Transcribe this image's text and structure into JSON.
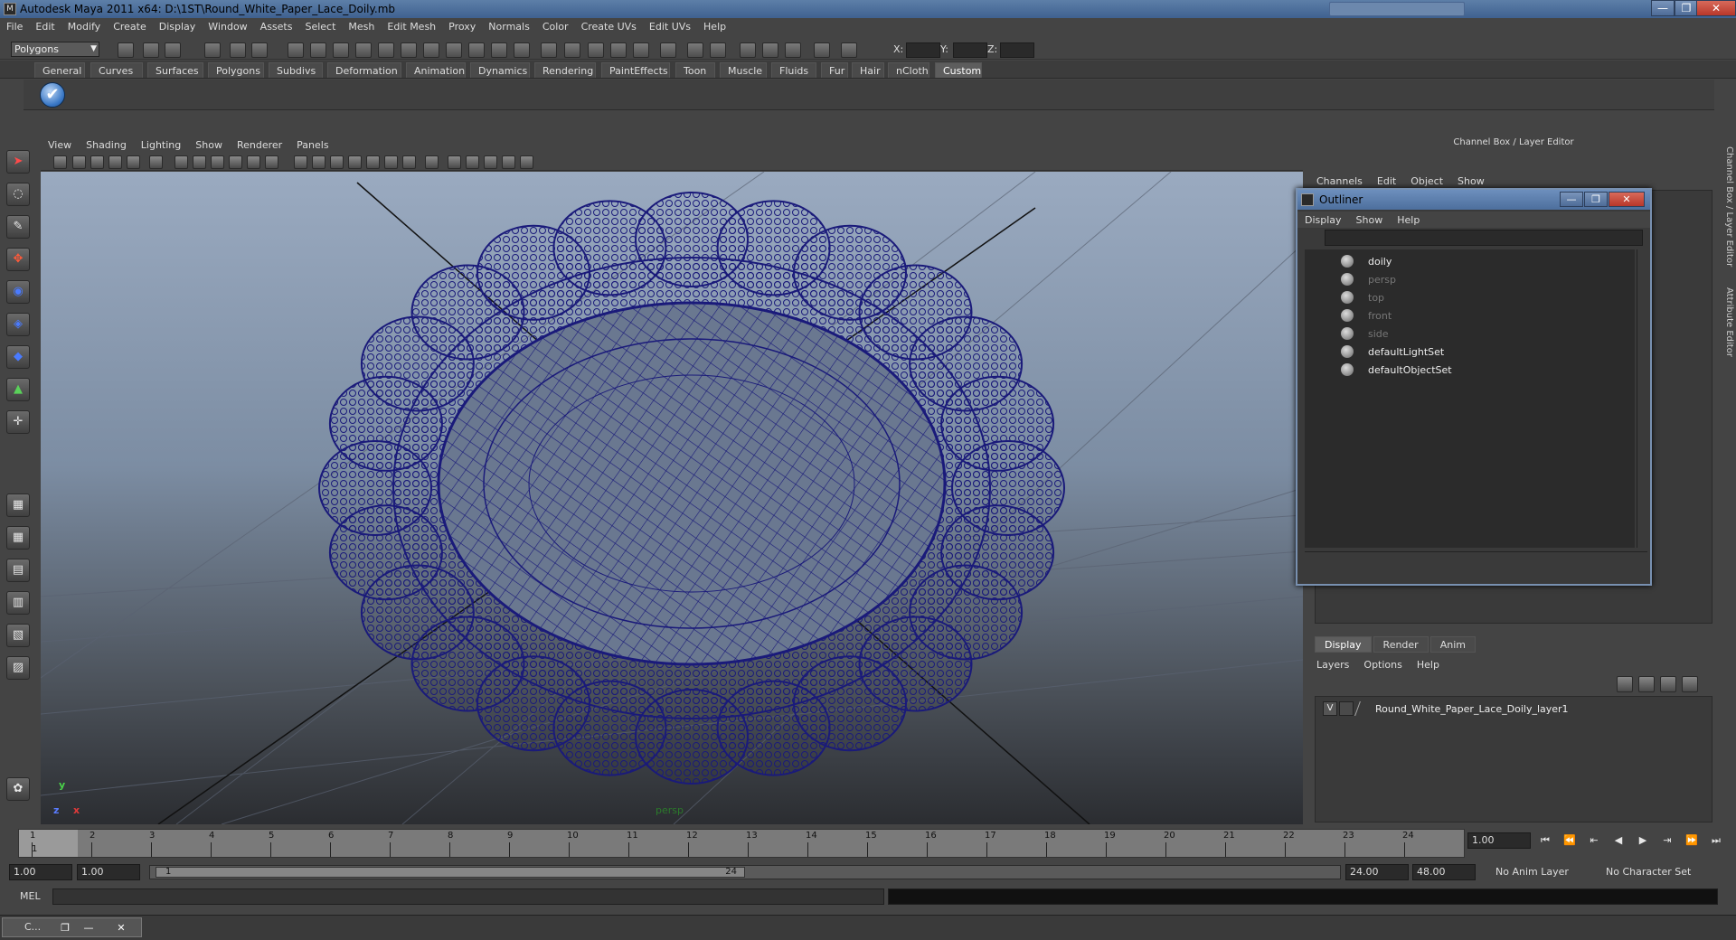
{
  "window": {
    "title": "Autodesk Maya 2011 x64: D:\\1ST\\Round_White_Paper_Lace_Doily.mb",
    "minimize": "—",
    "maximize": "❐",
    "close": "✕"
  },
  "menubar": [
    "File",
    "Edit",
    "Modify",
    "Create",
    "Display",
    "Window",
    "Assets",
    "Select",
    "Mesh",
    "Edit Mesh",
    "Proxy",
    "Normals",
    "Color",
    "Create UVs",
    "Edit UVs",
    "Help"
  ],
  "statusline": {
    "mode": "Polygons",
    "x_label": "X:",
    "y_label": "Y:",
    "z_label": "Z:"
  },
  "shelf": {
    "tabs": [
      "General",
      "Curves",
      "Surfaces",
      "Polygons",
      "Subdivs",
      "Deformation",
      "Animation",
      "Dynamics",
      "Rendering",
      "PaintEffects",
      "Toon",
      "Muscle",
      "Fluids",
      "Fur",
      "Hair",
      "nCloth",
      "Custom"
    ],
    "active_tab": "Custom",
    "button_icon": "checkmark-icon",
    "button_glyph": "✔"
  },
  "viewport": {
    "menu": [
      "View",
      "Shading",
      "Lighting",
      "Show",
      "Renderer",
      "Panels"
    ],
    "camera": "persp",
    "axis_x": "x",
    "axis_y": "y",
    "axis_z": "z",
    "wire_color": "#1a1a7a"
  },
  "channel_box": {
    "header": "Channel Box / Layer Editor",
    "menu": [
      "Channels",
      "Edit",
      "Object",
      "Show"
    ]
  },
  "side_tabs": [
    "Channel Box / Layer Editor",
    "Attribute Editor"
  ],
  "outliner": {
    "title": "Outliner",
    "menu": [
      "Display",
      "Show",
      "Help"
    ],
    "items": [
      {
        "label": "doily",
        "color": "#eeeeee"
      },
      {
        "label": "persp",
        "color": "#777777"
      },
      {
        "label": "top",
        "color": "#777777"
      },
      {
        "label": "front",
        "color": "#777777"
      },
      {
        "label": "side",
        "color": "#777777"
      },
      {
        "label": "defaultLightSet",
        "color": "#eeeeee"
      },
      {
        "label": "defaultObjectSet",
        "color": "#eeeeee"
      }
    ]
  },
  "layer_editor": {
    "tabs": [
      "Display",
      "Render",
      "Anim"
    ],
    "active_tab": "Display",
    "menu": [
      "Layers",
      "Options",
      "Help"
    ],
    "layer": {
      "visible": "V",
      "name": "Round_White_Paper_Lace_Doily_layer1"
    }
  },
  "timeslider": {
    "frames": [
      "1",
      "2",
      "3",
      "4",
      "5",
      "6",
      "7",
      "8",
      "9",
      "10",
      "11",
      "12",
      "13",
      "14",
      "15",
      "16",
      "17",
      "18",
      "19",
      "20",
      "21",
      "22",
      "23",
      "24"
    ],
    "current_marker": "1",
    "current_frame": "1.00",
    "playback": [
      "⏮",
      "⏪",
      "⇤",
      "◀",
      "▶",
      "⇥",
      "⏩",
      "⏭"
    ]
  },
  "range": {
    "start": "1.00",
    "playback_start": "1.00",
    "handle_start": "1",
    "handle_end": "24",
    "playback_end": "24.00",
    "end": "48.00",
    "anim_layer": "No Anim Layer",
    "character_set": "No Character Set"
  },
  "cmdline": {
    "label": "MEL"
  },
  "taskbar": {
    "item": "C..."
  }
}
